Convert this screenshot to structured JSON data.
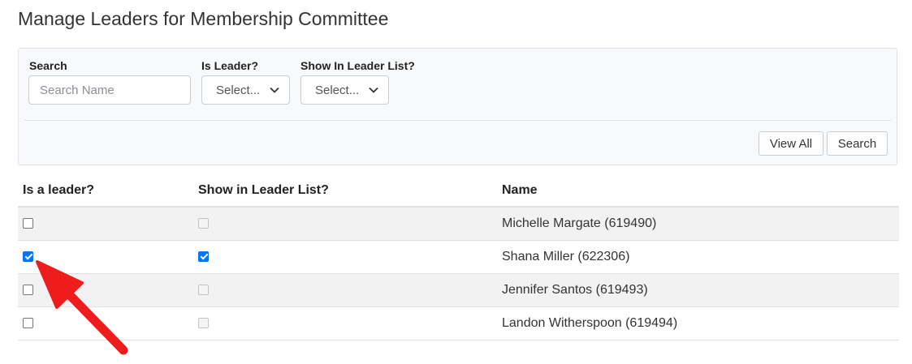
{
  "page": {
    "title": "Manage Leaders for Membership Committee"
  },
  "filters": {
    "search_label": "Search",
    "search_placeholder": "Search Name",
    "search_value": "",
    "is_leader_label": "Is Leader?",
    "is_leader_selected": "Select...",
    "show_in_list_label": "Show In Leader List?",
    "show_in_list_selected": "Select...",
    "view_all_label": "View All",
    "search_button_label": "Search"
  },
  "table": {
    "headers": [
      "Is a leader?",
      "Show in Leader List?",
      "Name"
    ],
    "rows": [
      {
        "is_leader": false,
        "show_in_list": false,
        "show_in_list_enabled": false,
        "name": "Michelle Margate (619490)"
      },
      {
        "is_leader": true,
        "show_in_list": true,
        "show_in_list_enabled": true,
        "name": "Shana Miller (622306)"
      },
      {
        "is_leader": false,
        "show_in_list": false,
        "show_in_list_enabled": false,
        "name": "Jennifer Santos (619493)"
      },
      {
        "is_leader": false,
        "show_in_list": false,
        "show_in_list_enabled": false,
        "name": "Landon Witherspoon (619494)"
      }
    ]
  },
  "annotation": {
    "icon": "red-arrow-icon",
    "color": "#ee1c1c",
    "points_to": "table.rows.1.is_leader"
  },
  "colors": {
    "accent": "#0075ff",
    "panel_bg": "#f8f9fa",
    "stripe": "#f2f2f2",
    "border": "#dee2e6"
  }
}
